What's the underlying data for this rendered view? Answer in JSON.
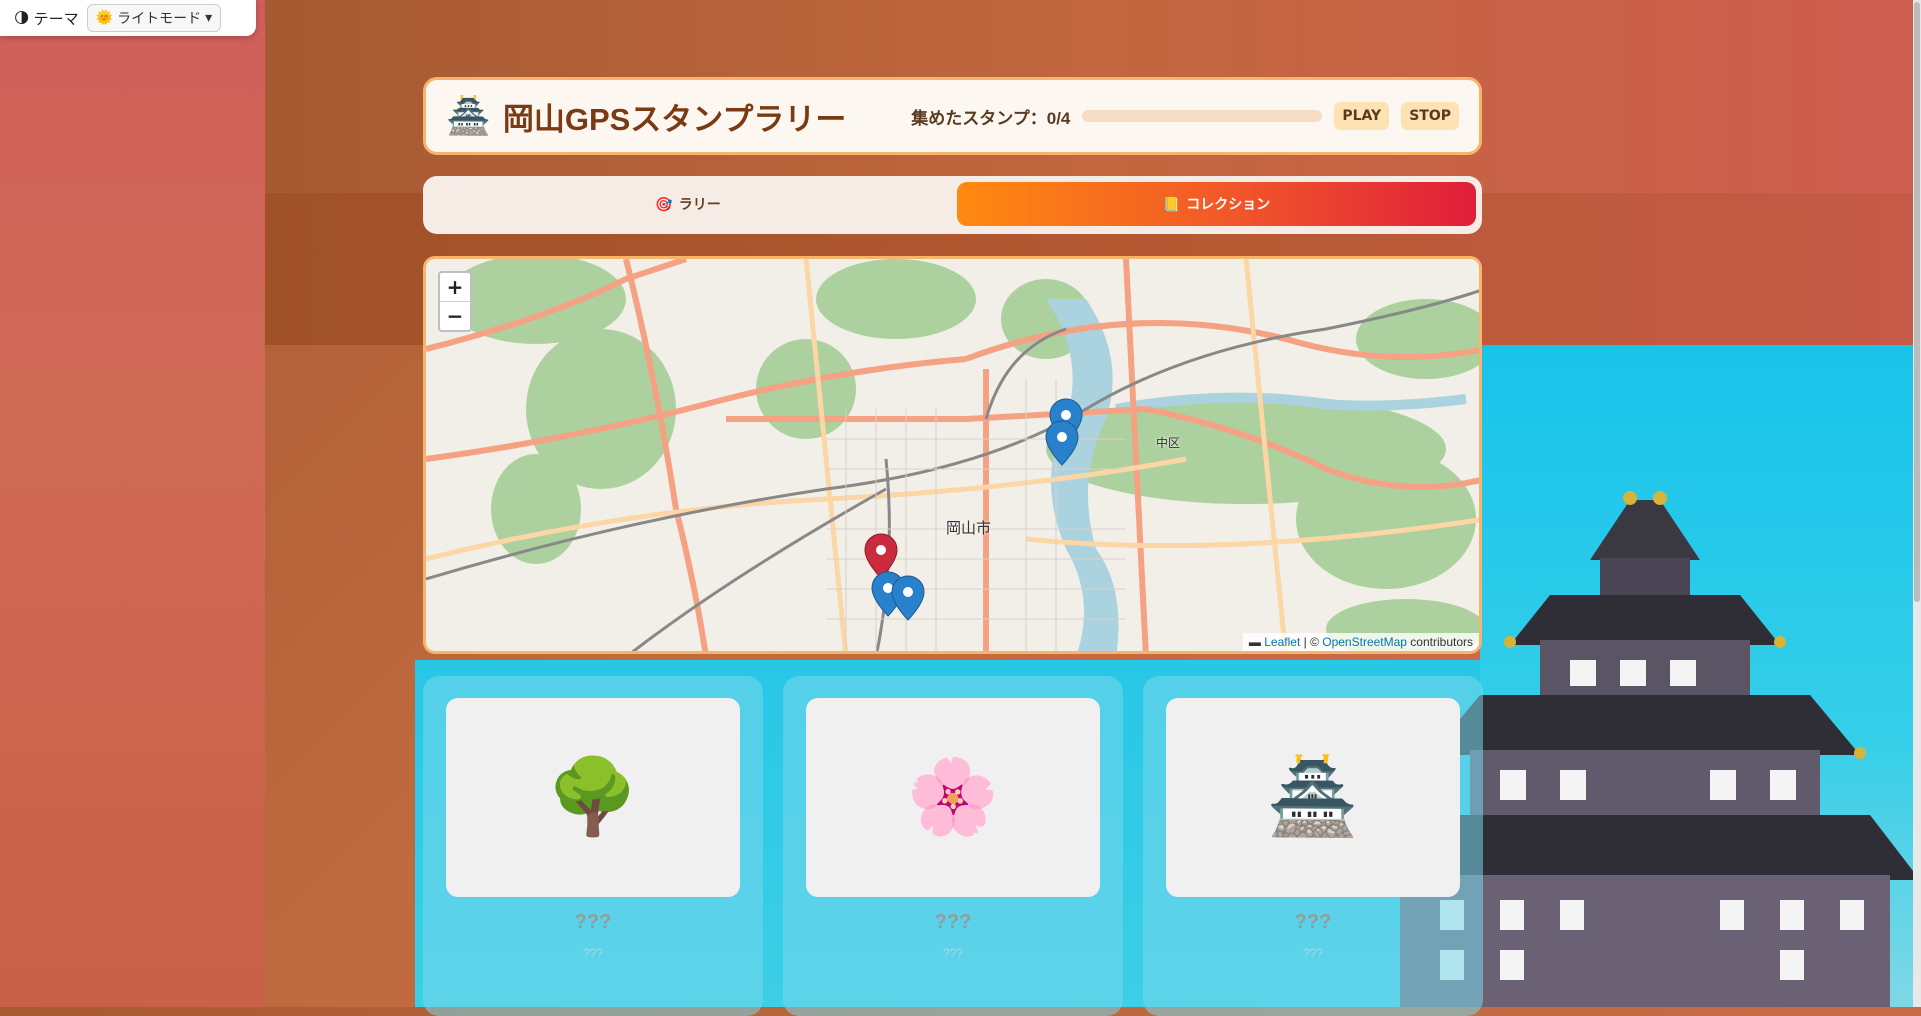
{
  "theme": {
    "label": "テーマ",
    "mode_selected": "ライトモード"
  },
  "header": {
    "icon": "castle-icon",
    "title": "岡山GPSスタンプラリー",
    "stamps_label": "集めたスタンプ：0/4",
    "progress": 0,
    "play_label": "PLAY",
    "stop_label": "STOP"
  },
  "tabs": [
    {
      "label": "ラリー",
      "icon": "target-icon"
    },
    {
      "label": "コレクション",
      "icon": "book-icon",
      "active": true
    }
  ],
  "map": {
    "zoom_in": "+",
    "zoom_out": "−",
    "city_label": "岡山市",
    "ward_label": "中区",
    "attribution_leaflet": "Leaflet",
    "attribution_sep": " | © ",
    "attribution_osm": "OpenStreetMap",
    "attribution_tail": " contributors"
  },
  "cards": [
    {
      "emoji": "🌳",
      "icon": "tree-icon",
      "name": "???",
      "sub": "???"
    },
    {
      "emoji": "🌸",
      "icon": "cherry-blossom-icon",
      "name": "???",
      "sub": "???"
    },
    {
      "emoji": "🏯",
      "icon": "castle-icon",
      "name": "???",
      "sub": "???"
    }
  ],
  "colors": {
    "accent": "#f38a2a",
    "active_tab_start": "#ff8a10",
    "active_tab_end": "#e01e3a",
    "title": "#7a3b12"
  }
}
